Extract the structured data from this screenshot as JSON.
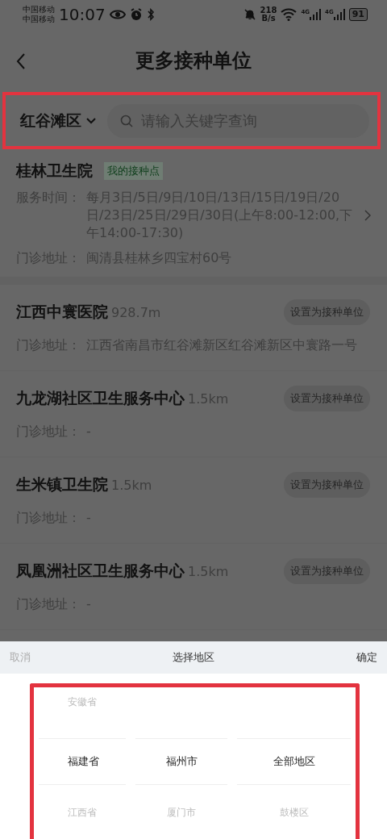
{
  "status_bar": {
    "carriers": [
      "中国移动",
      "中国移动"
    ],
    "time": "10:07",
    "net_speed": [
      "218",
      "B/s"
    ],
    "signal_labels": [
      "4G",
      "4G"
    ],
    "battery": "91"
  },
  "header": {
    "title": "更多接种单位"
  },
  "filter": {
    "region": "红谷滩区",
    "placeholder": "请输入关键字查询",
    "highlighted": true
  },
  "my_unit": {
    "name": "桂林卫生院",
    "tag": "我的接种点",
    "fields": [
      {
        "label": "服务时间：",
        "value": "每月3日/5日/9日/10日/13日/15日/19日/20日/23日/25日/29日/30日(上午8:00-12:00,下午14:00-17:30)",
        "expandable": true
      },
      {
        "label": "门诊地址：",
        "value": "闽清县桂林乡四宝村60号",
        "expandable": false
      }
    ]
  },
  "units": [
    {
      "name": "江西中寰医院",
      "distance": "928.7m",
      "button": "设置为接种单位",
      "address_label": "门诊地址：",
      "address": "江西省南昌市红谷滩新区红谷滩新区中寰路一号"
    },
    {
      "name": "九龙湖社区卫生服务中心",
      "distance": "1.5km",
      "button": "设置为接种单位",
      "address_label": "门诊地址：",
      "address": "-"
    },
    {
      "name": "生米镇卫生院",
      "distance": "1.5km",
      "button": "设置为接种单位",
      "address_label": "门诊地址：",
      "address": "-"
    },
    {
      "name": "凤凰洲社区卫生服务中心",
      "distance": "1.5km",
      "button": "设置为接种单位",
      "address_label": "门诊地址：",
      "address": "-"
    }
  ],
  "picker": {
    "cancel": "取消",
    "title": "选择地区",
    "confirm": "确定",
    "highlighted": true,
    "columns": [
      {
        "items": [
          {
            "label": "安徽省",
            "selected": false
          },
          {
            "label": "福建省",
            "selected": true
          },
          {
            "label": "江西省",
            "selected": false
          }
        ]
      },
      {
        "items": [
          {
            "label": "福州市",
            "selected": true
          },
          {
            "label": "厦门市",
            "selected": false
          }
        ]
      },
      {
        "items": [
          {
            "label": "全部地区",
            "selected": true
          },
          {
            "label": "鼓楼区",
            "selected": false
          }
        ]
      }
    ]
  }
}
